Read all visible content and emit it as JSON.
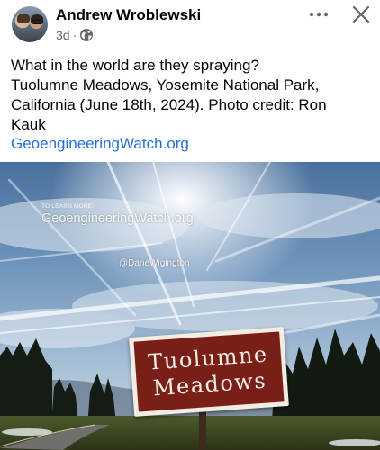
{
  "post": {
    "author": "Andrew Wroblewski",
    "time": "3d",
    "separator": "·",
    "audience_icon": "globe-icon",
    "more_icon": "more-dots-icon",
    "close_icon": "close-icon",
    "text_line1": "What in the world are they spraying?",
    "text_line2": "Tuolumne Meadows, Yosemite National Park,",
    "text_line3": "California (June 18th, 2024). Photo credit: Ron",
    "text_line4": "Kauk",
    "link": "GeoengineeringWatch.org"
  },
  "photo": {
    "watermark_small": "TO LEARN MORE:",
    "watermark_big": "GeoengineeringWatch.org",
    "watermark_handle": "@DaneWigington",
    "sign_line1": "Tuolumne",
    "sign_line2": "Meadows"
  },
  "colors": {
    "link": "#216fdb",
    "secondary_text": "#65676b",
    "sign_red": "#7a1f17"
  }
}
